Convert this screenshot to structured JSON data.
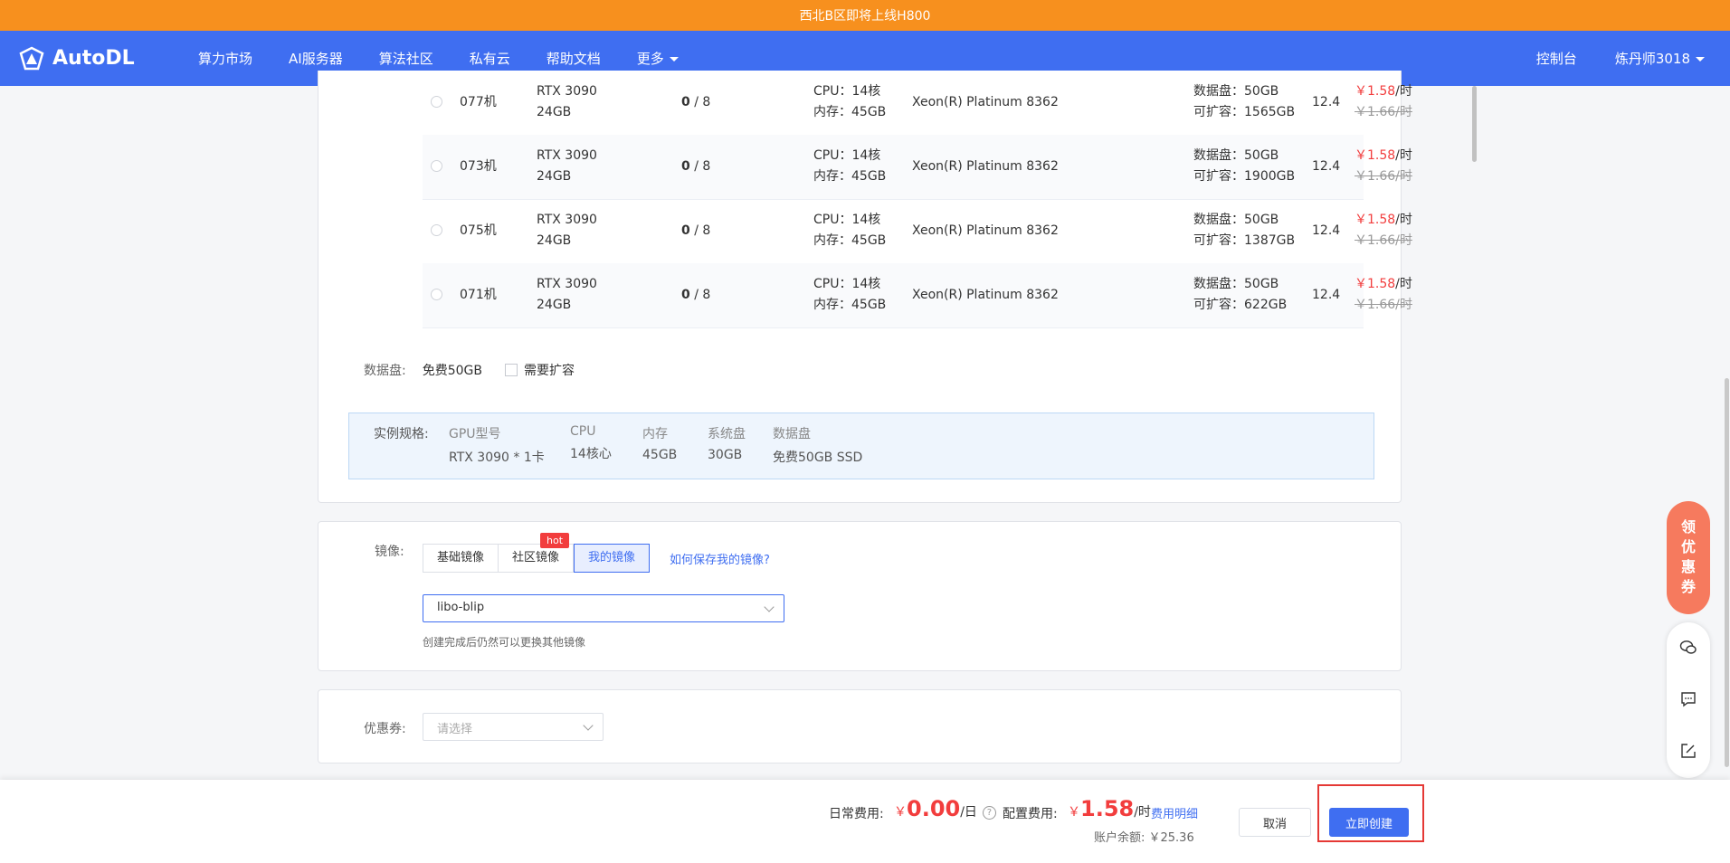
{
  "banner": "西北B区即将上线H800",
  "nav": {
    "logo": "AutoDL",
    "items": [
      "算力市场",
      "AI服务器",
      "算法社区",
      "私有云",
      "帮助文档",
      "更多"
    ],
    "console": "控制台",
    "user": "炼丹师3018"
  },
  "machines": [
    {
      "name": "077机",
      "gpu": "RTX 3090",
      "vram": "24GB",
      "avail_free": "0",
      "avail_total": " / 8",
      "cpu": "CPU：14核",
      "mem": "内存：45GB",
      "cpu_model": "Xeon(R) Platinum 8362",
      "disk": "数据盘：50GB",
      "expand": "可扩容：1565GB",
      "cuda": "12.4",
      "price": "￥1.58",
      "price_unit": "/时",
      "old_price": "￥1.66/时"
    },
    {
      "name": "073机",
      "gpu": "RTX 3090",
      "vram": "24GB",
      "avail_free": "0",
      "avail_total": " / 8",
      "cpu": "CPU：14核",
      "mem": "内存：45GB",
      "cpu_model": "Xeon(R) Platinum 8362",
      "disk": "数据盘：50GB",
      "expand": "可扩容：1900GB",
      "cuda": "12.4",
      "price": "￥1.58",
      "price_unit": "/时",
      "old_price": "￥1.66/时"
    },
    {
      "name": "075机",
      "gpu": "RTX 3090",
      "vram": "24GB",
      "avail_free": "0",
      "avail_total": " / 8",
      "cpu": "CPU：14核",
      "mem": "内存：45GB",
      "cpu_model": "Xeon(R) Platinum 8362",
      "disk": "数据盘：50GB",
      "expand": "可扩容：1387GB",
      "cuda": "12.4",
      "price": "￥1.58",
      "price_unit": "/时",
      "old_price": "￥1.66/时"
    },
    {
      "name": "071机",
      "gpu": "RTX 3090",
      "vram": "24GB",
      "avail_free": "0",
      "avail_total": " / 8",
      "cpu": "CPU：14核",
      "mem": "内存：45GB",
      "cpu_model": "Xeon(R) Platinum 8362",
      "disk": "数据盘：50GB",
      "expand": "可扩容：622GB",
      "cuda": "12.4",
      "price": "￥1.58",
      "price_unit": "/时",
      "old_price": "￥1.66/时"
    }
  ],
  "disk": {
    "label": "数据盘:",
    "free": "免费50GB",
    "expand_label": "需要扩容"
  },
  "spec": {
    "label": "实例规格:",
    "columns": [
      {
        "h": "GPU型号",
        "v": "RTX 3090 * 1卡"
      },
      {
        "h": "CPU",
        "v": "14核心"
      },
      {
        "h": "内存",
        "v": "45GB"
      },
      {
        "h": "系统盘",
        "v": "30GB"
      },
      {
        "h": "数据盘",
        "v": "免费50GB SSD"
      }
    ]
  },
  "mirror": {
    "label": "镜像:",
    "tabs": [
      "基础镜像",
      "社区镜像",
      "我的镜像"
    ],
    "hot": "hot",
    "how_link": "如何保存我的镜像?",
    "selected": "libo-blip",
    "hint": "创建完成后仍然可以更换其他镜像"
  },
  "coupon": {
    "label": "优惠券:",
    "placeholder": "请选择"
  },
  "footer": {
    "daily_label": "日常费用:",
    "daily_yen": "￥",
    "daily_value": "0.00",
    "daily_unit": "/日",
    "config_label": "配置费用:",
    "config_yen": "￥",
    "config_value": "1.58",
    "config_unit": "/时",
    "fee_detail": "费用明细",
    "balance": "账户余额: ￥25.36",
    "cancel": "取消",
    "create": "立即创建"
  },
  "promo": "领优惠券",
  "colors": {
    "primary": "#3f6ef1",
    "banner": "#f7901e",
    "price": "#f23d3d",
    "highlight": "#e53935"
  }
}
